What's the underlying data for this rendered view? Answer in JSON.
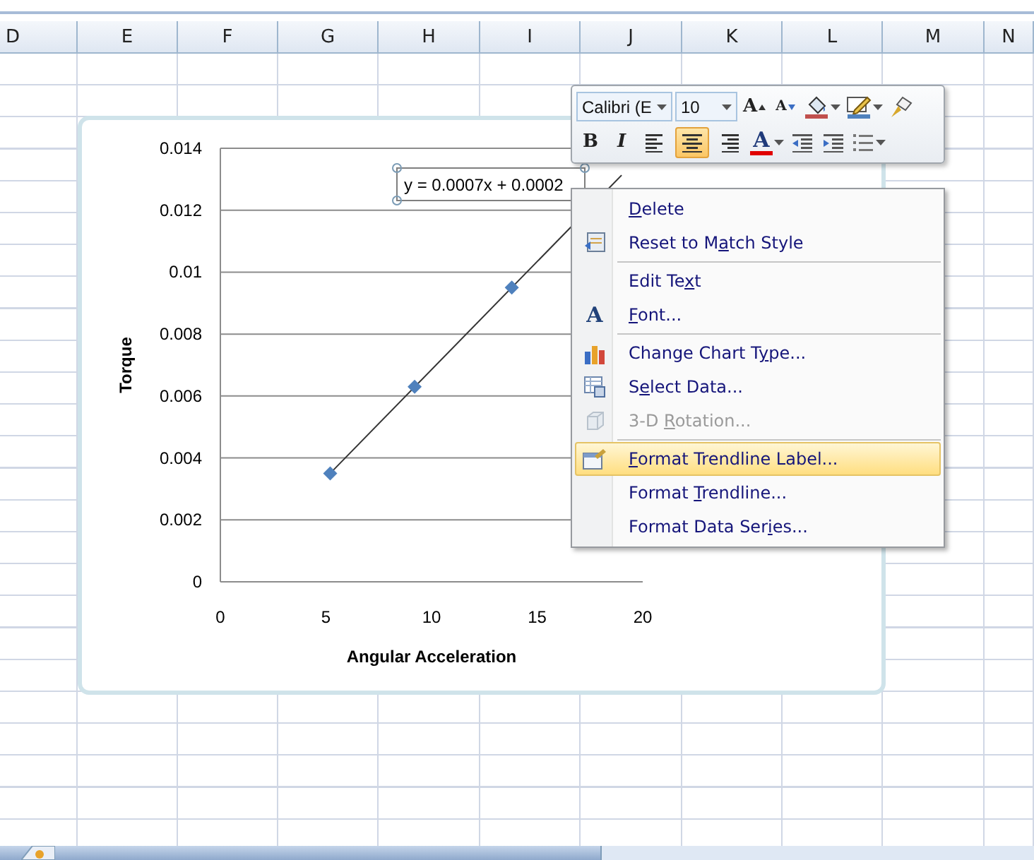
{
  "columns": [
    {
      "label": "D",
      "kind": "partial"
    },
    {
      "label": "E"
    },
    {
      "label": "F"
    },
    {
      "label": "G"
    },
    {
      "label": "H"
    },
    {
      "label": "I"
    },
    {
      "label": "J"
    },
    {
      "label": "K"
    },
    {
      "label": "L"
    },
    {
      "label": "M"
    },
    {
      "label": "N",
      "kind": "partial"
    }
  ],
  "chart": {
    "trendline_label": "y = 0.0007x + 0.0002",
    "selected": true,
    "chart_data": {
      "type": "scatter",
      "xlabel": "Angular Acceleration",
      "ylabel": "Torque",
      "xlim": [
        0,
        20
      ],
      "ylim": [
        0,
        0.014
      ],
      "xticks": [
        {
          "value": 0,
          "label": "0"
        },
        {
          "value": 5,
          "label": "5"
        },
        {
          "value": 10,
          "label": "10"
        },
        {
          "value": 15,
          "label": "15"
        },
        {
          "value": 20,
          "label": "20"
        }
      ],
      "yticks": [
        {
          "value": 0,
          "label": "0"
        },
        {
          "value": 0.002,
          "label": "0.002"
        },
        {
          "value": 0.004,
          "label": "0.004"
        },
        {
          "value": 0.006,
          "label": "0.006"
        },
        {
          "value": 0.008,
          "label": "0.008"
        },
        {
          "value": 0.01,
          "label": "0.01"
        },
        {
          "value": 0.012,
          "label": "0.012"
        },
        {
          "value": 0.014,
          "label": "0.014"
        }
      ],
      "grid": true,
      "series": [
        {
          "color": "#4f81bd",
          "x": [
            5.2,
            9.2,
            13.8
          ],
          "values": [
            0.0035,
            0.0063,
            0.0095
          ]
        }
      ]
    }
  },
  "mini_toolbar": {
    "font": "Calibri (E",
    "size": "10",
    "row_1": [
      {
        "kind": "grow",
        "label": "A"
      },
      {
        "kind": "shrink",
        "label": "A"
      },
      {
        "kind": "fill"
      },
      {
        "kind": "outline"
      },
      {
        "kind": "painter"
      }
    ],
    "row_2": [
      {
        "kind": "bold",
        "label": "B",
        "selected": false
      },
      {
        "kind": "italic",
        "label": "I",
        "selected": false
      },
      {
        "kind": "align-left",
        "selected": false
      },
      {
        "kind": "align-center",
        "selected": true
      },
      {
        "kind": "align-right",
        "selected": false
      },
      {
        "kind": "font-color",
        "label": "A",
        "selected": false
      },
      {
        "kind": "outdent",
        "selected": false
      },
      {
        "kind": "indent",
        "selected": false
      },
      {
        "kind": "bullets",
        "selected": false
      }
    ]
  },
  "context_menu": [
    {
      "kind": "plain",
      "key": "D",
      "post": "elete",
      "disabled": false,
      "selected": false
    },
    {
      "kind": "reset",
      "pre": "Reset to M",
      "key": "a",
      "post": "tch Style",
      "disabled": false,
      "selected": false
    },
    {
      "kind": "separator"
    },
    {
      "kind": "plain",
      "pre": "Edit Te",
      "key": "x",
      "post": "t",
      "disabled": false,
      "selected": false
    },
    {
      "kind": "font",
      "glyph": "A",
      "key": "F",
      "post": "ont...",
      "disabled": false,
      "selected": false
    },
    {
      "kind": "separator"
    },
    {
      "kind": "chart",
      "pre": "Change Chart T",
      "key": "y",
      "post": "pe...",
      "disabled": false,
      "selected": false
    },
    {
      "kind": "table",
      "pre": "S",
      "key": "e",
      "post": "lect Data...",
      "disabled": false,
      "selected": false
    },
    {
      "kind": "cube",
      "pre": "3-D ",
      "key": "R",
      "post": "otation...",
      "disabled": true,
      "selected": false
    },
    {
      "kind": "separator"
    },
    {
      "kind": "format",
      "key": "F",
      "post": "ormat Trendline Label...",
      "disabled": false,
      "selected": true
    },
    {
      "kind": "plain",
      "pre": "Format ",
      "key": "T",
      "post": "rendline...",
      "disabled": false,
      "selected": false
    },
    {
      "kind": "plain",
      "pre": "Format Data Ser",
      "key": "i",
      "post": "es...",
      "disabled": false,
      "selected": false
    }
  ]
}
